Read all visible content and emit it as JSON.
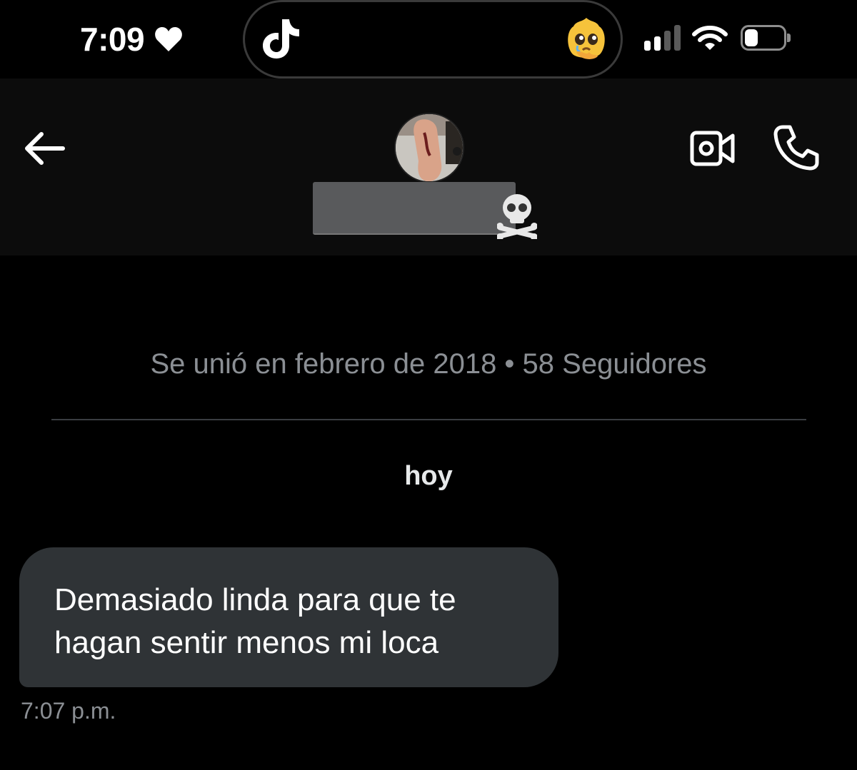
{
  "status_bar": {
    "time": "7:09",
    "icons": [
      "heart-icon",
      "tiktok-icon",
      "pleading-face-emoji",
      "cellular-signal-icon",
      "wifi-icon",
      "battery-icon"
    ],
    "signal_bars_active": 2,
    "signal_bars_total": 4,
    "battery_level": 0.35
  },
  "header": {
    "icons": [
      "back-arrow-icon",
      "profile-avatar",
      "skull-crossbones-emoji",
      "video-camera-icon",
      "phone-icon"
    ]
  },
  "conversation": {
    "joined_info": "Se unió en febrero de 2018 • 58 Seguidores",
    "day_label": "hoy",
    "messages": [
      {
        "text": "Demasiado linda para que te\nhagan sentir menos mi loca",
        "time": "7:07 p.m."
      }
    ]
  },
  "colors": {
    "background": "#000000",
    "header_background": "#0c0c0c",
    "bubble": "#2f3336",
    "muted_text": "#8b8f94",
    "redaction": "#595a5c"
  }
}
